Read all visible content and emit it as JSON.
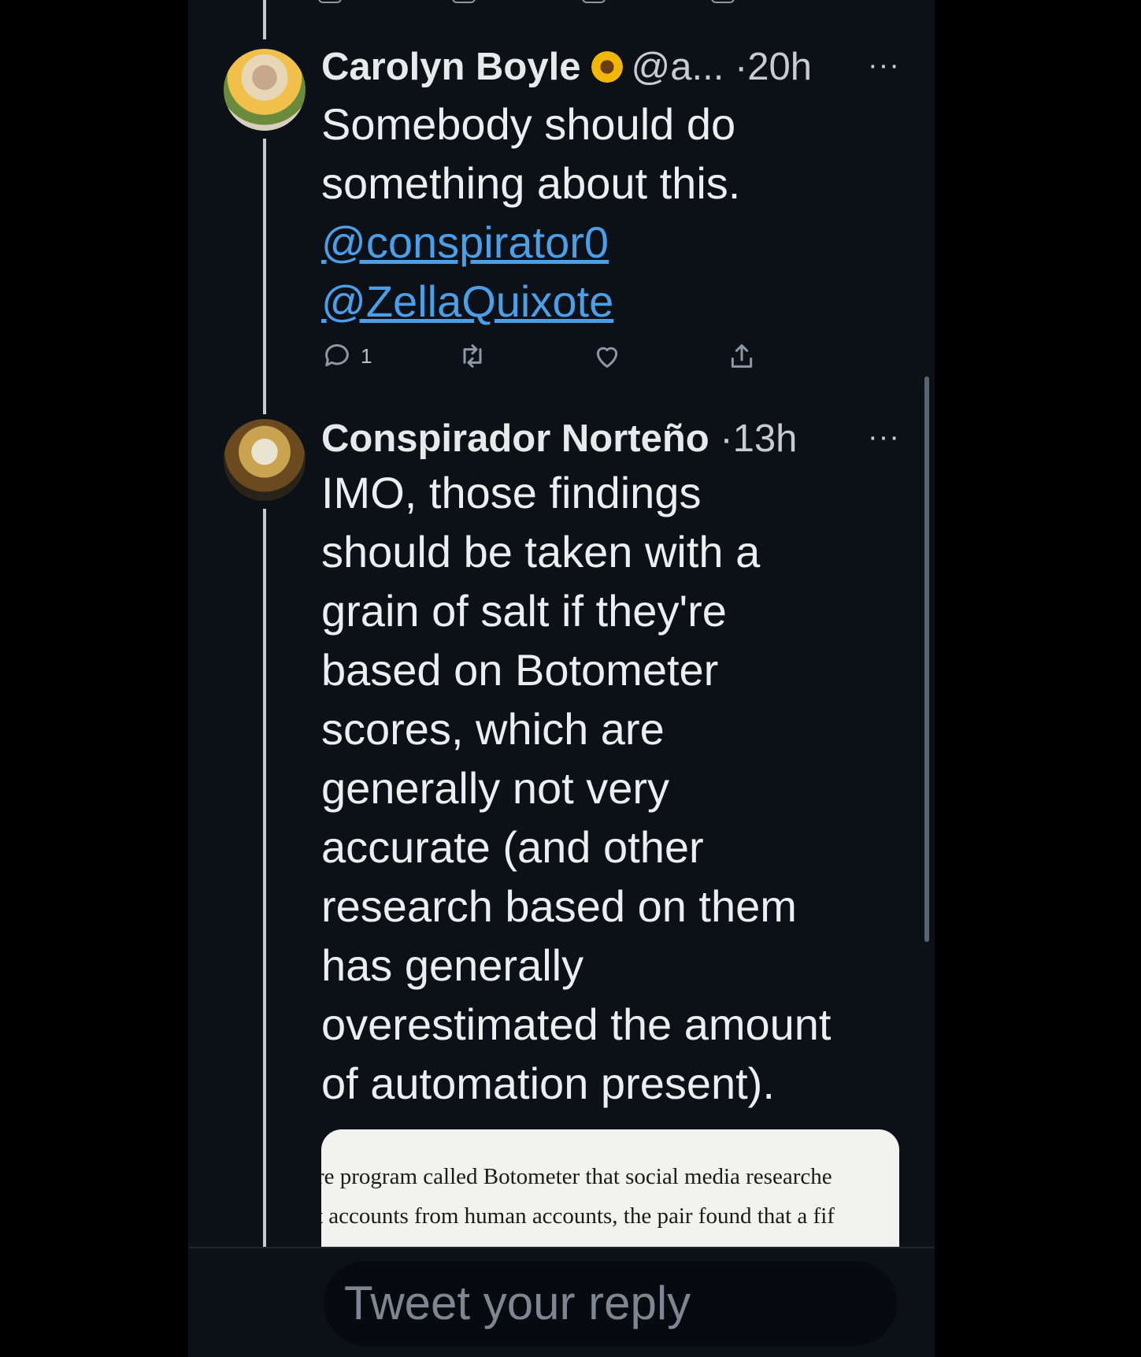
{
  "tweets": [
    {
      "name": "Carolyn Boyle",
      "handle": "@a...",
      "time": "·20h",
      "more": "···",
      "text_lines": [
        "Somebody should do",
        "something about this."
      ],
      "mentions": [
        "@conspirator0",
        "@ZellaQuixote"
      ],
      "reply_count": "1"
    },
    {
      "name": "Conspirador Norteño",
      "time": "·13h",
      "more": "···",
      "text_lines": [
        "IMO, those findings",
        "should be taken with a",
        "grain of salt if they're",
        "based on Botometer",
        "scores, which are",
        "generally not very",
        "accurate (and other",
        "research based on them",
        "has generally",
        "overestimated the amount",
        "of automation present)."
      ],
      "quote_lines": [
        "re program called Botometer that social media researche",
        "t accounts from human accounts, the pair found that a fif"
      ]
    }
  ],
  "reply": {
    "placeholder": "Tweet your reply"
  },
  "icons": {
    "reply": "reply-icon",
    "retweet": "retweet-icon",
    "like": "heart-icon",
    "share": "share-icon",
    "flower": "sunflower-emoji-icon"
  },
  "colors": {
    "background": "#0c1017",
    "mention": "#4a9fe8",
    "text": "#eceef0",
    "muted": "#8b98a5"
  }
}
